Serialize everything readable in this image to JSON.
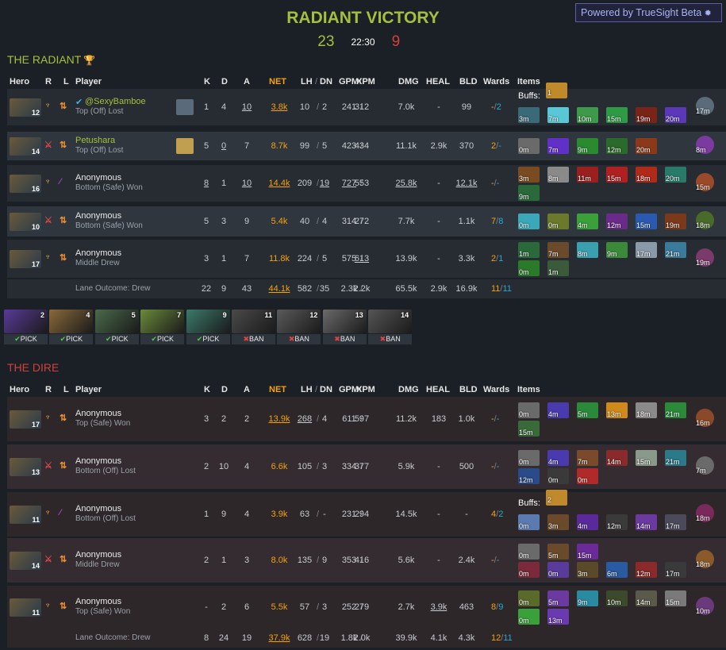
{
  "header": {
    "title": "RADIANT VICTORY",
    "radiant_score": "23",
    "time": "22:30",
    "dire_score": "9",
    "powered": "Powered by TrueSight Beta"
  },
  "colors": {
    "radiant": "#a5c03b",
    "dire": "#d0413c",
    "net": "#f4a20d",
    "ward_obs": "#f4a20d",
    "ward_sen": "#27a8d8"
  },
  "columns": {
    "hero": "Hero",
    "r": "R",
    "l": "L",
    "player": "Player",
    "k": "K",
    "d": "D",
    "a": "A",
    "net": "NET",
    "lh": "LH",
    "dn": "DN",
    "gpm": "GPM",
    "xpm": "XPM",
    "dmg": "DMG",
    "heal": "HEAL",
    "bld": "BLD",
    "wards": "Wards",
    "items": "Items",
    "slash": "/"
  },
  "radiant": {
    "title": "THE RADIANT",
    "players": [
      {
        "level": "12",
        "name": "@SexyBamboe",
        "verified": true,
        "lane": "Top (Off) Lost",
        "k": "1",
        "d": "4",
        "a": "10",
        "net": "3.8k",
        "lh": "10",
        "dn": "2",
        "gpm": "241",
        "xpm": "312",
        "dmg": "7.0k",
        "heal": "-",
        "bld": "99",
        "obs": "-",
        "sen": "2",
        "buffs": "Buffs:",
        "buff_count": "1",
        "items": [
          {
            "t": "3m",
            "c": "#3a6a78"
          },
          {
            "t": "7m",
            "c": "#58c7d6"
          },
          {
            "t": "10m",
            "c": "#3c9a4a"
          },
          {
            "t": "15m",
            "c": "#2e9a44"
          },
          {
            "t": "19m",
            "c": "#7a2418"
          },
          {
            "t": "20m",
            "c": "#5a38b8"
          }
        ],
        "neutral": {
          "t": "17m",
          "c": "#5a6b7a"
        }
      },
      {
        "level": "14",
        "name": "Petushara",
        "verified": false,
        "lane": "Top (Off) Lost",
        "k": "5",
        "d": "0",
        "a": "7",
        "net": "8.7k",
        "lh": "99",
        "dn": "5",
        "gpm": "423",
        "xpm": "434",
        "dmg": "11.1k",
        "heal": "2.9k",
        "bld": "370",
        "obs": "2",
        "sen": "-",
        "items": [
          {
            "t": "0m",
            "c": "#6a6a6a"
          },
          {
            "t": "7m",
            "c": "#6030c8"
          },
          {
            "t": "9m",
            "c": "#2a8a30"
          },
          {
            "t": "12m",
            "c": "#2a6a2a"
          },
          {
            "t": "20m",
            "c": "#8a3a1a"
          }
        ],
        "neutral": {
          "t": "8m",
          "c": "#7a3aa0"
        }
      },
      {
        "level": "16",
        "name": "Anonymous",
        "verified": false,
        "lane": "Bottom (Safe) Won",
        "k": "8",
        "d": "1",
        "a": "10",
        "net": "14.4k",
        "lh": "209",
        "dn": "19",
        "gpm": "727",
        "xpm": "553",
        "dmg": "25.8k",
        "heal": "-",
        "bld": "12.1k",
        "obs": "-",
        "sen": "-",
        "items": [
          {
            "t": "3m",
            "c": "#7a4a20"
          },
          {
            "t": "8m",
            "c": "#8a8a8a"
          },
          {
            "t": "11m",
            "c": "#9a2020"
          },
          {
            "t": "15m",
            "c": "#b02020"
          },
          {
            "t": "18m",
            "c": "#b02a1a"
          },
          {
            "t": "20m",
            "c": "#2a7a6a"
          },
          {
            "t": "9m",
            "c": "#2a6a3a"
          }
        ],
        "neutral": {
          "t": "15m",
          "c": "#9a4a2a"
        }
      },
      {
        "level": "10",
        "name": "Anonymous",
        "verified": false,
        "lane": "Bottom (Safe) Won",
        "k": "5",
        "d": "3",
        "a": "9",
        "net": "5.4k",
        "lh": "40",
        "dn": "4",
        "gpm": "314",
        "xpm": "272",
        "dmg": "7.7k",
        "heal": "-",
        "bld": "1.1k",
        "obs": "7",
        "sen": "8",
        "items": [
          {
            "t": "0m",
            "c": "#3aa8b8"
          },
          {
            "t": "0m",
            "c": "#6a7a2a"
          },
          {
            "t": "4m",
            "c": "#3aa03a"
          },
          {
            "t": "12m",
            "c": "#6a2a8a"
          },
          {
            "t": "15m",
            "c": "#2a5ab0"
          },
          {
            "t": "19m",
            "c": "#7a3a1a"
          }
        ],
        "neutral": {
          "t": "18m",
          "c": "#4a6a2a"
        }
      },
      {
        "level": "17",
        "name": "Anonymous",
        "verified": false,
        "lane": "Middle Drew",
        "k": "3",
        "d": "1",
        "a": "7",
        "net": "11.8k",
        "lh": "224",
        "dn": "5",
        "gpm": "575",
        "xpm": "613",
        "dmg": "13.9k",
        "heal": "-",
        "bld": "3.3k",
        "obs": "2",
        "sen": "1",
        "items": [
          {
            "t": "1m",
            "c": "#2a6a3a"
          },
          {
            "t": "7m",
            "c": "#6a4a2a"
          },
          {
            "t": "8m",
            "c": "#3aa0b0"
          },
          {
            "t": "9m",
            "c": "#3a8a3a"
          },
          {
            "t": "17m",
            "c": "#8a9aa8"
          },
          {
            "t": "21m",
            "c": "#3a7a9a"
          },
          {
            "t": "0m",
            "c": "#2a7a2a"
          },
          {
            "t": "1m",
            "c": "#3a5a3a"
          }
        ],
        "neutral": {
          "t": "19m",
          "c": "#7a3a6a"
        }
      }
    ],
    "totals": {
      "lane_outcome": "Lane Outcome: Drew",
      "k": "22",
      "d": "9",
      "a": "43",
      "net": "44.1k",
      "lh": "582",
      "dn": "35",
      "gpm": "2.3k",
      "xpm": "2.2k",
      "dmg": "65.5k",
      "heal": "2.9k",
      "bld": "16.9k",
      "obs": "11",
      "sen": "11"
    }
  },
  "draft": [
    {
      "num": "2",
      "label": "PICK",
      "type": "pick",
      "c": "#5a3a9a"
    },
    {
      "num": "4",
      "label": "PICK",
      "type": "pick",
      "c": "#8a6a3a"
    },
    {
      "num": "5",
      "label": "PICK",
      "type": "pick",
      "c": "#4a6a4a"
    },
    {
      "num": "7",
      "label": "PICK",
      "type": "pick",
      "c": "#6a8a3a"
    },
    {
      "num": "9",
      "label": "PICK",
      "type": "pick",
      "c": "#3a7a6a"
    },
    {
      "num": "11",
      "label": "BAN",
      "type": "ban",
      "c": "#4a4a4a"
    },
    {
      "num": "12",
      "label": "BAN",
      "type": "ban",
      "c": "#5a5a5a"
    },
    {
      "num": "13",
      "label": "BAN",
      "type": "ban",
      "c": "#6a6a6a"
    },
    {
      "num": "14",
      "label": "BAN",
      "type": "ban",
      "c": "#555555"
    }
  ],
  "draft_icons": {
    "pick": "✔",
    "ban": "✖"
  },
  "dire": {
    "title": "THE DIRE",
    "players": [
      {
        "level": "17",
        "name": "Anonymous",
        "lane": "Top (Safe) Won",
        "k": "3",
        "d": "2",
        "a": "2",
        "net": "13.9k",
        "lh": "268",
        "dn": "4",
        "gpm": "611",
        "xpm": "597",
        "dmg": "11.2k",
        "heal": "183",
        "bld": "1.0k",
        "obs": "-",
        "sen": "-",
        "items": [
          {
            "t": "0m",
            "c": "#6a6a6a"
          },
          {
            "t": "4m",
            "c": "#4a3ab0"
          },
          {
            "t": "5m",
            "c": "#2a8a3a"
          },
          {
            "t": "13m",
            "c": "#d08a1a"
          },
          {
            "t": "18m",
            "c": "#8a8a8a"
          },
          {
            "t": "21m",
            "c": "#2a8a3a"
          },
          {
            "t": "15m",
            "c": "#3a6a3a"
          }
        ],
        "neutral": {
          "t": "16m",
          "c": "#8a4a2a"
        }
      },
      {
        "level": "13",
        "name": "Anonymous",
        "lane": "Bottom (Off) Lost",
        "k": "2",
        "d": "10",
        "a": "4",
        "net": "6.6k",
        "lh": "105",
        "dn": "3",
        "gpm": "334",
        "xpm": "377",
        "dmg": "5.9k",
        "heal": "-",
        "bld": "500",
        "obs": "-",
        "sen": "-",
        "items": [
          {
            "t": "0m",
            "c": "#6a6a6a"
          },
          {
            "t": "4m",
            "c": "#4a3ab0"
          },
          {
            "t": "7m",
            "c": "#7a4a2a"
          },
          {
            "t": "14m",
            "c": "#8a2a2a"
          },
          {
            "t": "15m",
            "c": "#8a9a8a"
          },
          {
            "t": "21m",
            "c": "#2a7a8a"
          },
          {
            "t": "12m",
            "c": "#2a4a8a"
          },
          {
            "t": "0m",
            "c": "#3a3a3a"
          },
          {
            "t": "0m",
            "c": "#b02a2a"
          }
        ],
        "neutral": {
          "t": "7m",
          "c": "#6a6a6a"
        }
      },
      {
        "level": "11",
        "name": "Anonymous",
        "lane": "Bottom (Off) Lost",
        "k": "1",
        "d": "9",
        "a": "4",
        "net": "3.9k",
        "lh": "63",
        "dn": "-",
        "gpm": "231",
        "xpm": "294",
        "dmg": "14.5k",
        "heal": "-",
        "bld": "-",
        "obs": "4",
        "sen": "2",
        "buffs": "Buffs:",
        "buff_count": "2",
        "items": [
          {
            "t": "0m",
            "c": "#5a7ab0"
          },
          {
            "t": "3m",
            "c": "#6a4a2a"
          },
          {
            "t": "4m",
            "c": "#5a2a9a"
          },
          {
            "t": "12m",
            "c": "#3a3a3a"
          },
          {
            "t": "14m",
            "c": "#6a3aa0"
          },
          {
            "t": "17m",
            "c": "#4a4a5a"
          }
        ],
        "neutral": {
          "t": "18m",
          "c": "#7a2a5a"
        }
      },
      {
        "level": "14",
        "name": "Anonymous",
        "lane": "Middle Drew",
        "k": "2",
        "d": "1",
        "a": "3",
        "net": "8.0k",
        "lh": "135",
        "dn": "9",
        "gpm": "353",
        "xpm": "416",
        "dmg": "5.6k",
        "heal": "-",
        "bld": "2.4k",
        "obs": "-",
        "sen": "-",
        "items": [
          {
            "t": "0m",
            "c": "#6a6a6a"
          },
          {
            "t": "5m",
            "c": "#6a4a2a"
          },
          {
            "t": "15m",
            "c": "#6a2a9a"
          },
          {
            "t": "0m",
            "c": "#7a2a3a"
          },
          {
            "t": "0m",
            "c": "#5a3a9a"
          },
          {
            "t": "3m",
            "c": "#5a4a2a"
          },
          {
            "t": "6m",
            "c": "#2a5aa0"
          },
          {
            "t": "12m",
            "c": "#8a2a2a"
          },
          {
            "t": "17m",
            "c": "#3a3a3a"
          }
        ],
        "neutral": {
          "t": "18m",
          "c": "#8a5a2a"
        }
      },
      {
        "level": "11",
        "name": "Anonymous",
        "lane": "Top (Safe) Won",
        "k": "-",
        "d": "2",
        "a": "6",
        "net": "5.5k",
        "lh": "57",
        "dn": "3",
        "gpm": "252",
        "xpm": "279",
        "dmg": "2.7k",
        "heal": "3.9k",
        "bld": "463",
        "obs": "8",
        "sen": "9",
        "items": [
          {
            "t": "0m",
            "c": "#5a6a2a"
          },
          {
            "t": "5m",
            "c": "#6a3aa0"
          },
          {
            "t": "9m",
            "c": "#2a8aa0"
          },
          {
            "t": "10m",
            "c": "#3a4a2a"
          },
          {
            "t": "14m",
            "c": "#5a5a4a"
          },
          {
            "t": "15m",
            "c": "#7a7a7a"
          },
          {
            "t": "0m",
            "c": "#3aa03a"
          },
          {
            "t": "13m",
            "c": "#6a3ab0"
          }
        ],
        "neutral": {
          "t": "10m",
          "c": "#6a3a7a"
        }
      }
    ],
    "totals": {
      "lane_outcome": "Lane Outcome: Drew",
      "k": "8",
      "d": "24",
      "a": "19",
      "net": "37.9k",
      "lh": "628",
      "dn": "19",
      "gpm": "1.8k",
      "xpm": "2.0k",
      "dmg": "39.9k",
      "heal": "4.1k",
      "bld": "4.3k",
      "obs": "12",
      "sen": "11"
    }
  },
  "icons": {
    "trophy": "trophy-icon",
    "role_core": "ᛉ",
    "role_support": "✈"
  }
}
